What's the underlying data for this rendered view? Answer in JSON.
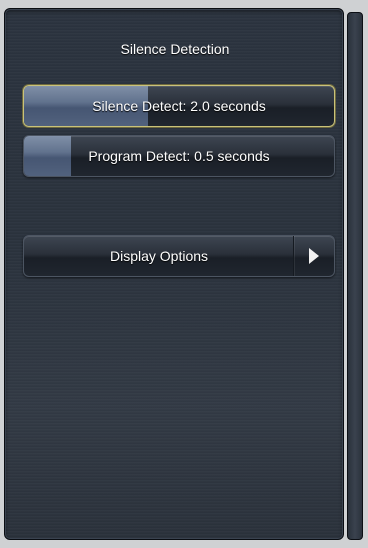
{
  "panel": {
    "title": "Silence Detection"
  },
  "settings": [
    {
      "label": "Silence Detect: 2.0 seconds",
      "level_fraction": 0.4,
      "selected": true
    },
    {
      "label": "Program Detect: 0.5 seconds",
      "level_fraction": 0.15,
      "selected": false
    }
  ],
  "display_options": {
    "label": "Display Options",
    "icon": "play-arrow-icon"
  }
}
